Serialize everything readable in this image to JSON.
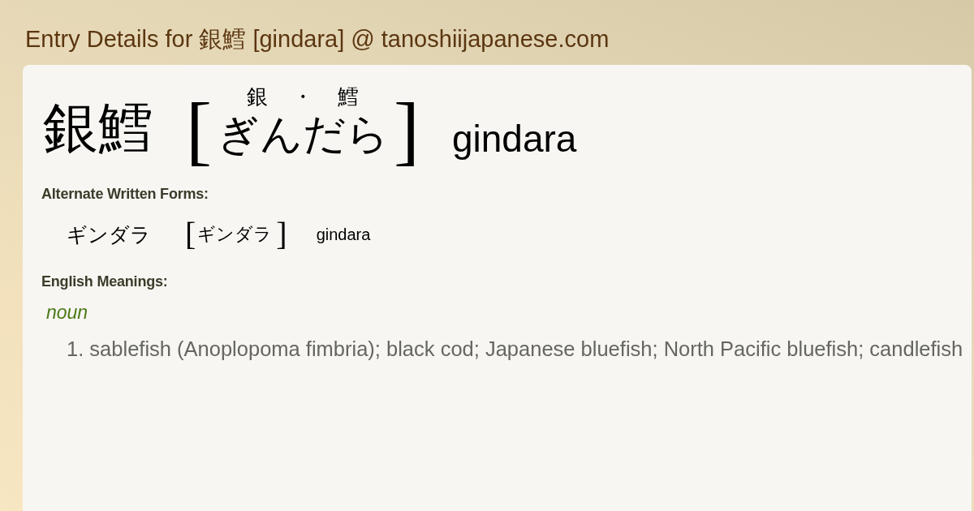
{
  "page_title": "Entry Details for 銀鱈 [gindara] @ tanoshiijapanese.com",
  "entry": {
    "headword": "銀鱈",
    "bracket_open": "[",
    "furigana": [
      "銀",
      "・",
      "鱈"
    ],
    "reading": "ぎんだら",
    "bracket_close": "]",
    "romaji": "gindara"
  },
  "alternate_forms": {
    "heading": "Alternate Written Forms:",
    "forms": [
      {
        "written": "ギンダラ",
        "bracket_open": "[",
        "reading": "ギンダラ",
        "bracket_close": "]",
        "romaji": "gindara"
      }
    ]
  },
  "english_meanings": {
    "heading": "English Meanings:",
    "groups": [
      {
        "part_of_speech": "noun",
        "senses": [
          {
            "number": "1.",
            "text": "sablefish (Anoplopoma fimbria); black cod; Japanese bluefish; North Pacific bluefish; candlefish"
          }
        ]
      }
    ]
  }
}
